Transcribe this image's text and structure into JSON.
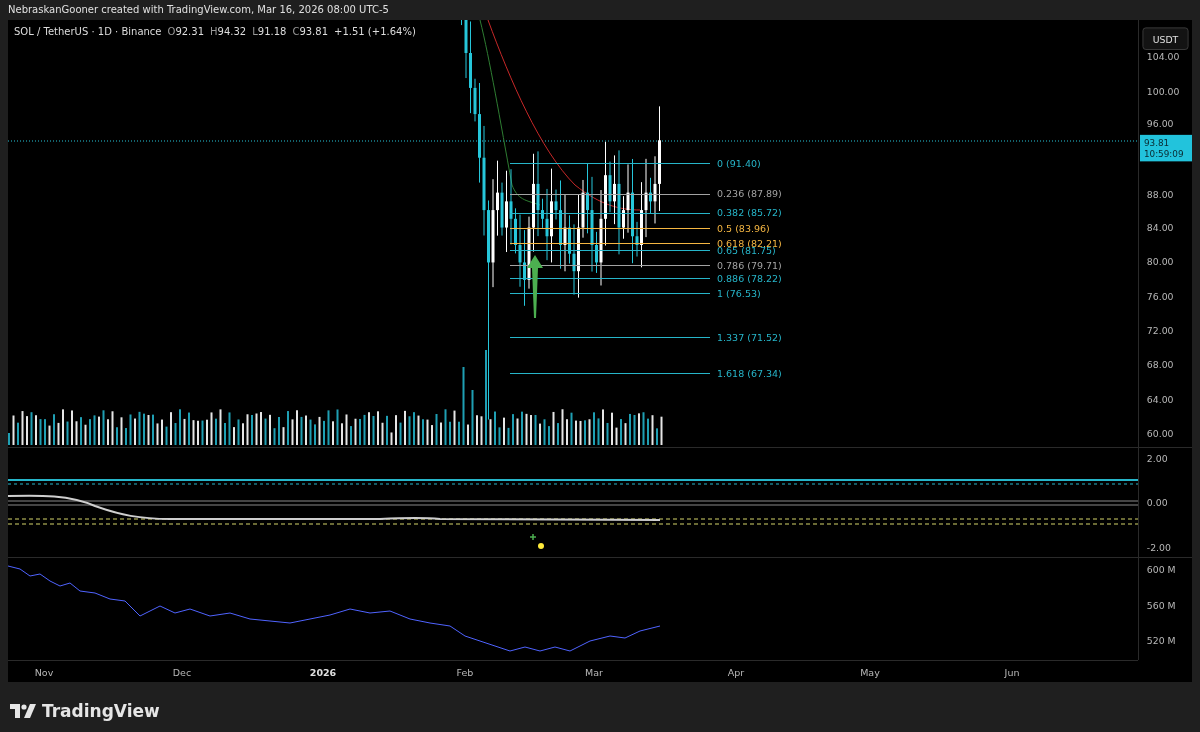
{
  "attribution": "NebraskanGooner created with TradingView.com, Mar 16, 2026 08:00 UTC-5",
  "symbol": {
    "title": "SOL / TetherUS · 1D · Binance",
    "ohlc": [
      {
        "label": "O",
        "value": "92.31"
      },
      {
        "label": "H",
        "value": "94.32"
      },
      {
        "label": "L",
        "value": "91.18"
      },
      {
        "label": "C",
        "value": "93.81"
      }
    ],
    "change": "+1.51 (+1.64%)"
  },
  "price_axis": {
    "currency": "USDT",
    "ticks": [
      "104.00",
      "100.00",
      "96.00",
      "88.00",
      "84.00",
      "80.00",
      "76.00",
      "72.00",
      "68.00",
      "64.00",
      "60.00"
    ],
    "last_price": "93.81",
    "countdown": "10:59:09"
  },
  "fib_levels": [
    {
      "label": "0 (91.40)",
      "color": "#26b5c9"
    },
    {
      "label": "0.236 (87.89)",
      "color": "#a3a3a3"
    },
    {
      "label": "0.382 (85.72)",
      "color": "#26b5c9"
    },
    {
      "label": "0.5 (83.96)",
      "color": "#f5b642"
    },
    {
      "label": "0.618 (82.21)",
      "color": "#f5b642"
    },
    {
      "label": "0.65 (81.75)",
      "color": "#26b5c9"
    },
    {
      "label": "0.786 (79.71)",
      "color": "#a3a3a3"
    },
    {
      "label": "0.886 (78.22)",
      "color": "#26b5c9"
    },
    {
      "label": "1 (76.53)",
      "color": "#26b5c9"
    },
    {
      "label": "1.337 (71.52)",
      "color": "#26b5c9"
    },
    {
      "label": "1.618 (67.34)",
      "color": "#26b5c9"
    }
  ],
  "oscillator_axis": {
    "ticks": [
      "2.00",
      "0.00",
      "-2.00"
    ]
  },
  "volume_axis": {
    "ticks": [
      "600 M",
      "560 M",
      "520 M"
    ]
  },
  "time_axis": {
    "ticks": [
      {
        "label": "Nov",
        "kind": "month"
      },
      {
        "label": "Dec",
        "kind": "month"
      },
      {
        "label": "2026",
        "kind": "year"
      },
      {
        "label": "Feb",
        "kind": "month"
      },
      {
        "label": "Mar",
        "kind": "month"
      },
      {
        "label": "Apr",
        "kind": "month"
      },
      {
        "label": "May",
        "kind": "month"
      },
      {
        "label": "Jun",
        "kind": "month"
      }
    ]
  },
  "logo": {
    "text": "TradingView"
  }
}
